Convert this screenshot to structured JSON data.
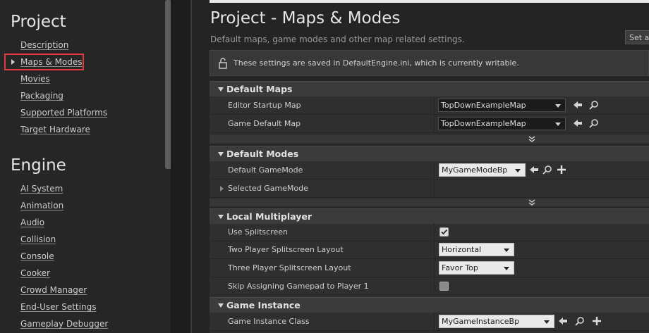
{
  "sidebar": {
    "sections": [
      {
        "title": "Project",
        "items": [
          "Description",
          "Maps & Modes",
          "Movies",
          "Packaging",
          "Supported Platforms",
          "Target Hardware"
        ],
        "selected_index": 1
      },
      {
        "title": "Engine",
        "items": [
          "AI System",
          "Animation",
          "Audio",
          "Collision",
          "Console",
          "Cooker",
          "Crowd Manager",
          "End-User Settings",
          "Gameplay Debugger"
        ]
      }
    ]
  },
  "page": {
    "title": "Project - Maps & Modes",
    "subtitle": "Default maps, game modes and other map related settings.",
    "set_as_button": "Set as",
    "notice": "These settings are saved in DefaultEngine.ini, which is currently writable."
  },
  "sections": {
    "default_maps": {
      "title": "Default Maps",
      "rows": [
        {
          "label": "Editor Startup Map",
          "value": "TopDownExampleMap"
        },
        {
          "label": "Game Default Map",
          "value": "TopDownExampleMap"
        }
      ]
    },
    "default_modes": {
      "title": "Default Modes",
      "rows": [
        {
          "label": "Default GameMode",
          "value": "MyGameModeBp"
        },
        {
          "label": "Selected GameMode",
          "value": ""
        }
      ]
    },
    "local_multiplayer": {
      "title": "Local Multiplayer",
      "rows": [
        {
          "label": "Use Splitscreen",
          "checked": true
        },
        {
          "label": "Two Player Splitscreen Layout",
          "value": "Horizontal"
        },
        {
          "label": "Three Player Splitscreen Layout",
          "value": "Favor Top"
        },
        {
          "label": "Skip Assigning Gamepad to Player 1",
          "checked": false
        }
      ]
    },
    "game_instance": {
      "title": "Game Instance",
      "rows": [
        {
          "label": "Game Instance Class",
          "value": "MyGameInstanceBp"
        }
      ]
    }
  },
  "icons": {
    "arrow": "arrow-left-icon",
    "browse": "magnifier-icon",
    "add": "plus-icon",
    "lock": "unlock-icon",
    "expand": "double-chevron-down-icon"
  },
  "colors": {
    "selection_outline": "#e0383e"
  }
}
